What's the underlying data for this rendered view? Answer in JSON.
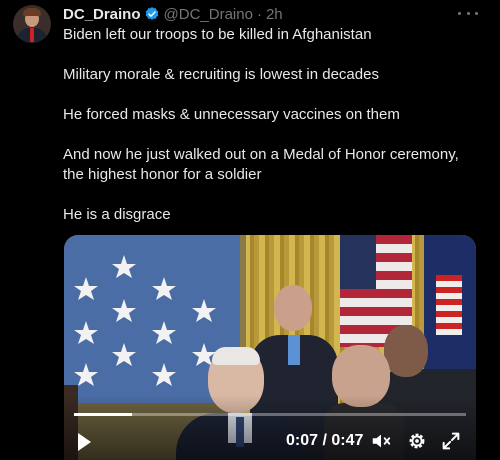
{
  "tweet": {
    "display_name": "DC_Draino",
    "handle": "@DC_Draino",
    "separator": "·",
    "timestamp": "2h",
    "verified_badge_color": "#1d9bf0",
    "paragraphs": [
      "Biden left our troops to be killed in Afghanistan",
      "Military morale & recruiting is lowest in decades",
      "He forced masks & unnecessary vaccines on them",
      "And now he just walked out on a Medal of Honor ceremony, the highest honor for a soldier",
      "He is a disgrace"
    ]
  },
  "video": {
    "current_time": "0:07",
    "time_divider": "/",
    "duration": "0:47",
    "progress_fraction": 0.149
  },
  "icons": {
    "more": "more-icon",
    "verified": "verified-badge-icon",
    "play": "play-icon",
    "mute": "mute-icon",
    "settings": "gear-icon",
    "fullscreen": "fullscreen-icon"
  }
}
